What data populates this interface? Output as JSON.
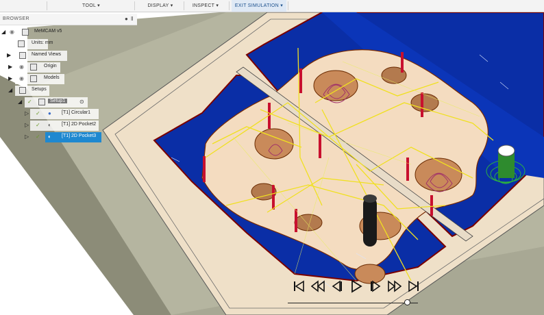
{
  "toolbar": {
    "tool": "TOOL ▾",
    "display": "DISPLAY ▾",
    "inspect": "INSPECT ▾",
    "exit": "EXIT SIMULATION ▾"
  },
  "browser": {
    "title": "BROWSER",
    "items": [
      {
        "label": "MeMCAM v5"
      },
      {
        "label": "Units: mm"
      },
      {
        "label": "Named Views"
      },
      {
        "label": "Origin"
      },
      {
        "label": "Models"
      },
      {
        "label": "Setups"
      },
      {
        "label": "Setup1"
      },
      {
        "label": "[T1] Circular1"
      },
      {
        "label": "[T1] 2D Pocket2"
      },
      {
        "label": "[T1] 2D Pocket3"
      }
    ]
  },
  "player": {
    "progress": 0.92,
    "buttons": [
      "to-start",
      "step-back-fast",
      "step-back",
      "play",
      "step-forward",
      "step-forward-fast",
      "to-end"
    ]
  },
  "colors": {
    "stock_wood": "#f4dcc0",
    "pocket_blue": "#0a2ea6",
    "fixture_gray": "#9b9b86",
    "toolpath_yellow": "#f0e020",
    "selection_blue": "#1e88d0"
  }
}
